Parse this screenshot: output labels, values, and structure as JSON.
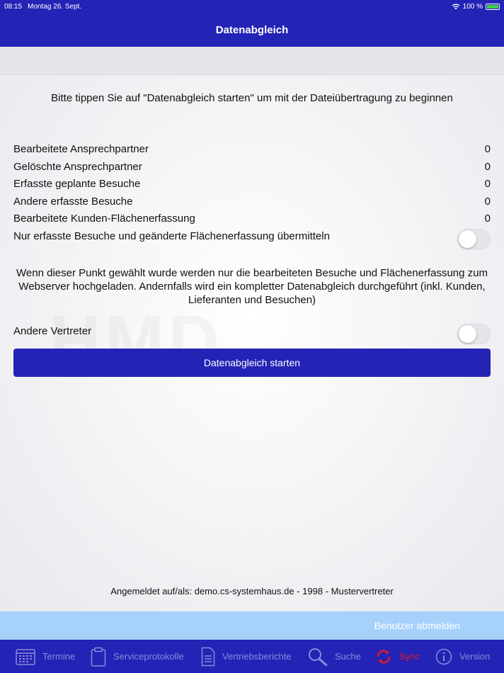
{
  "status": {
    "time": "08:15",
    "date": "Montag 26. Sept.",
    "battery": "100 %"
  },
  "nav": {
    "title": "Datenabgleich"
  },
  "intro": "Bitte tippen Sie auf \"Datenabgleich starten\" um mit der Dateiübertragung zu beginnen",
  "stats": [
    {
      "label": "Bearbeitete Ansprechpartner",
      "value": "0"
    },
    {
      "label": "Gelöschte Ansprechpartner",
      "value": "0"
    },
    {
      "label": "Erfasste geplante Besuche",
      "value": "0"
    },
    {
      "label": "Andere erfasste Besuche",
      "value": "0"
    },
    {
      "label": "Bearbeitete Kunden-Flächenerfassung",
      "value": "0"
    }
  ],
  "only_visits": {
    "label": "Nur erfasste Besuche und geänderte Flächenerfassung übermitteln",
    "enabled": false
  },
  "explanation": "Wenn dieser Punkt gewählt wurde werden nur die bearbeiteten Besuche und Flächenerfassung zum Webserver hochgeladen. Andernfalls wird ein kompletter Datenabgleich durchgeführt (inkl. Kunden, Lieferanten und Besuchen)",
  "other_rep": {
    "label": "Andere Vertreter",
    "enabled": false
  },
  "start_button": "Datenabgleich starten",
  "logged_in": "Angemeldet auf/als:  demo.cs-systemhaus.de - 1998 - Mustervertreter",
  "logout": "Benutzer abmelden",
  "tabs": [
    {
      "label": "Termine",
      "icon": "calendar-icon",
      "active": false
    },
    {
      "label": "Serviceprotokolle",
      "icon": "clipboard-icon",
      "active": false
    },
    {
      "label": "Vertriebsberichte",
      "icon": "document-icon",
      "active": false
    },
    {
      "label": "Suche",
      "icon": "search-icon",
      "active": false
    },
    {
      "label": "Sync",
      "icon": "sync-icon",
      "active": true
    },
    {
      "label": "Version",
      "icon": "info-icon",
      "active": false
    }
  ],
  "colors": {
    "primary": "#2323b5",
    "active_tab": "#e11a2a",
    "logout_bar": "#a6d1fb"
  }
}
